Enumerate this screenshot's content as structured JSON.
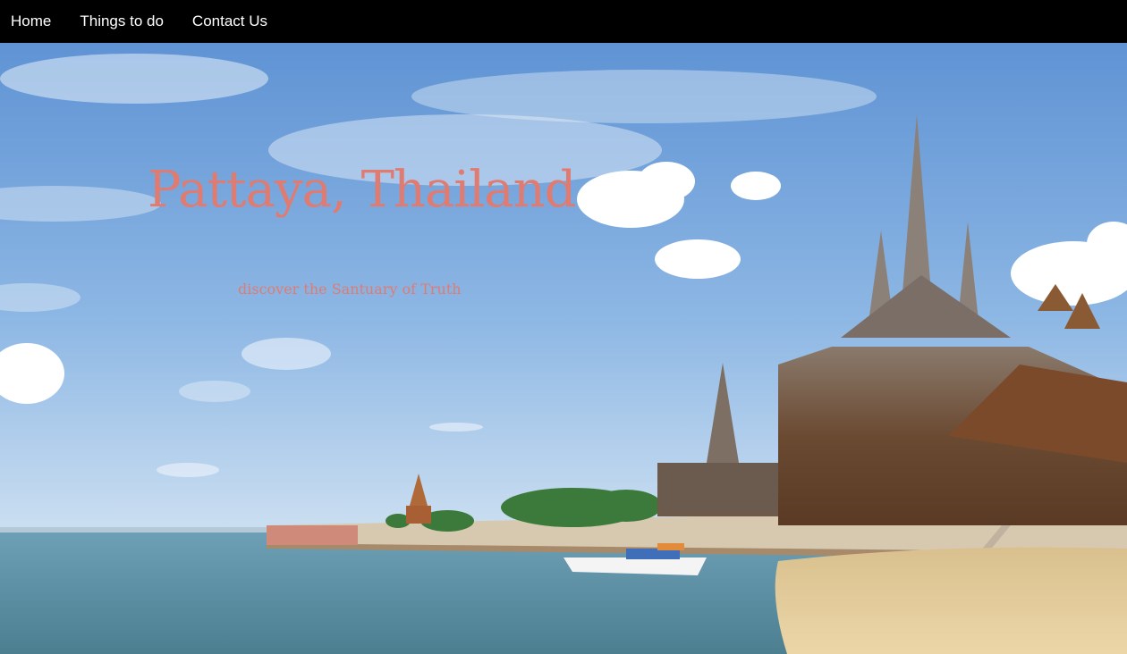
{
  "nav": {
    "items": [
      {
        "label": "Home"
      },
      {
        "label": "Things to do"
      },
      {
        "label": "Contact Us"
      }
    ]
  },
  "hero": {
    "title": "Pattaya, Thailand",
    "subtitle": "discover the Santuary of Truth"
  },
  "colors": {
    "nav_bg": "#000000",
    "nav_text": "#ffffff",
    "title_color": "#e07b72",
    "sky_top": "#5a8fd0",
    "sea": "#5e8fa0",
    "sand": "#e6cf9e",
    "temple_wood": "#7a4a2a"
  }
}
